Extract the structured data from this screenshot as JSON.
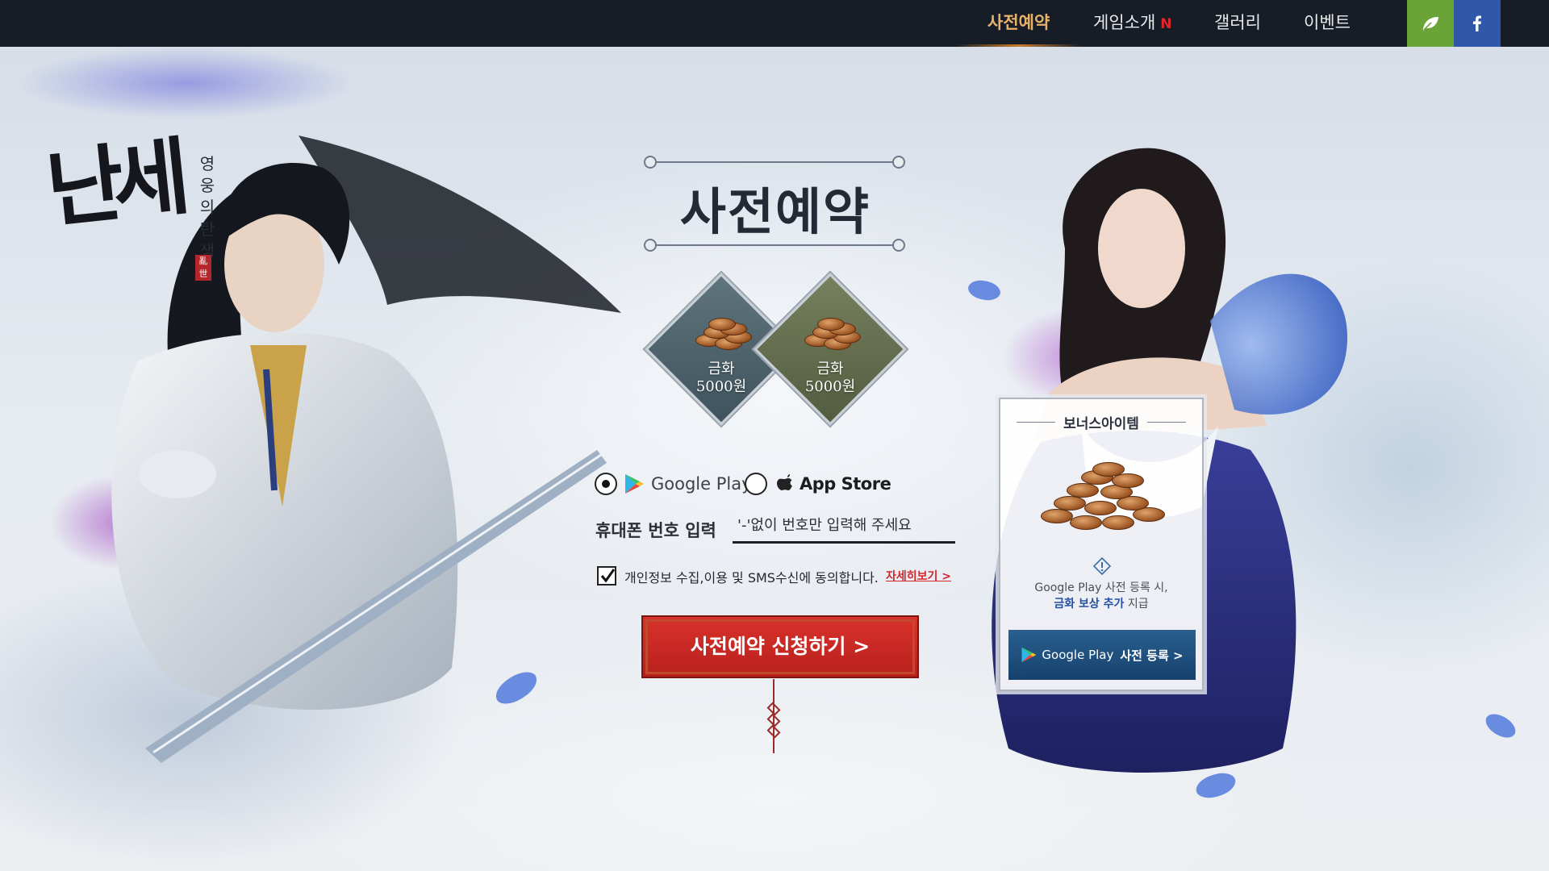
{
  "nav": {
    "items": [
      {
        "label": "사전예약",
        "active": true
      },
      {
        "label": "게임소개",
        "badge": "N"
      },
      {
        "label": "갤러리"
      },
      {
        "label": "이벤트"
      }
    ],
    "sns": [
      "line-icon",
      "facebook-icon"
    ]
  },
  "logo": {
    "main": "난세",
    "sub": "영웅의탄생",
    "seal": "亂世"
  },
  "preorder": {
    "title": "사전예약",
    "rewards": [
      {
        "name": "금화",
        "amount": "5000원"
      },
      {
        "name": "금화",
        "amount": "5000원"
      }
    ],
    "stores": [
      {
        "label": "Google Play",
        "selected": true
      },
      {
        "label": "App Store",
        "selected": false
      }
    ],
    "phone_label": "휴대폰 번호 입력",
    "phone_placeholder": "'-'없이 번호만 입력해 주세요",
    "agree_text": "개인정보 수집,이용 및 SMS수신에 동의합니다.",
    "agree_checked": true,
    "agree_more": "자세히보기 >",
    "submit_label": "사전예약 신청하기 >"
  },
  "bonus": {
    "title": "보너스아이템",
    "desc_line1": "Google Play 사전 등록 시,",
    "desc_highlight": "금화 보상 추가",
    "desc_tail": " 지급",
    "button_store": "Google Play",
    "button_label": "사전 등록 >"
  },
  "colors": {
    "nav_bg": "#171d27",
    "nav_active": "#e9b26a",
    "new_badge": "#e2262a",
    "line_green": "#6aa436",
    "facebook_blue": "#2f58a8",
    "submit_red": "#c8261f",
    "bonus_button": "#1f4f7d"
  }
}
